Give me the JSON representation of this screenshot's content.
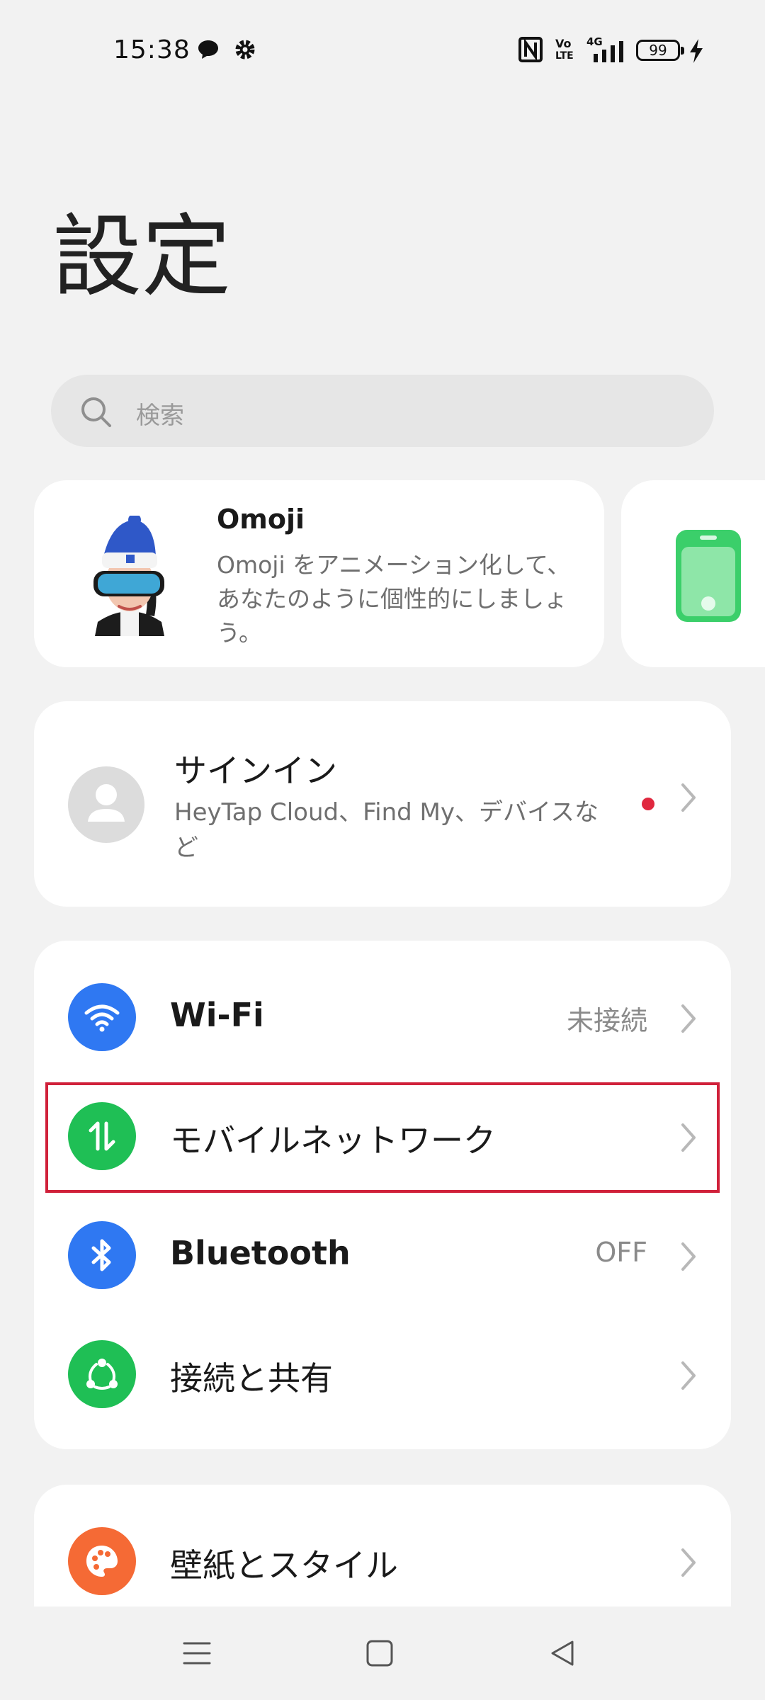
{
  "status_bar": {
    "time": "15:38",
    "icons": [
      "chat-bubble-icon",
      "gear-icon",
      "nfc-icon",
      "volte-icon",
      "4g-signal-icon",
      "battery-icon",
      "charging-icon"
    ],
    "volte_label_top": "Vo",
    "volte_label_bottom": "LTE",
    "network_label": "4G",
    "battery_level": "99"
  },
  "header": {
    "title": "設定"
  },
  "search": {
    "placeholder": "検索"
  },
  "omoji_card": {
    "title": "Omoji",
    "description": "Omoji をアニメーション化して、あなたのように個性的にしましょう。"
  },
  "signin_card": {
    "title": "サインイン",
    "description": "HeyTap Cloud、Find My、デバイスなど",
    "notification_color": "#e0283f"
  },
  "network_section": {
    "items": [
      {
        "label": "Wi-Fi",
        "value": "未接続",
        "icon": "wifi-icon",
        "color": "#2f78f2"
      },
      {
        "label": "モバイルネットワーク",
        "value": "",
        "icon": "mobile-data-icon",
        "color": "#1fbf55"
      },
      {
        "label": "Bluetooth",
        "value": "OFF",
        "icon": "bluetooth-icon",
        "color": "#2f78f2"
      },
      {
        "label": "接続と共有",
        "value": "",
        "icon": "share-icon",
        "color": "#1fbf55"
      }
    ]
  },
  "personalization_section": {
    "items": [
      {
        "label": "壁紙とスタイル",
        "icon": "palette-icon",
        "color": "#f56a35"
      }
    ]
  },
  "nav_bar": {
    "buttons": [
      "menu-icon",
      "home-icon",
      "back-icon"
    ]
  },
  "highlight_color": "#d0203a"
}
